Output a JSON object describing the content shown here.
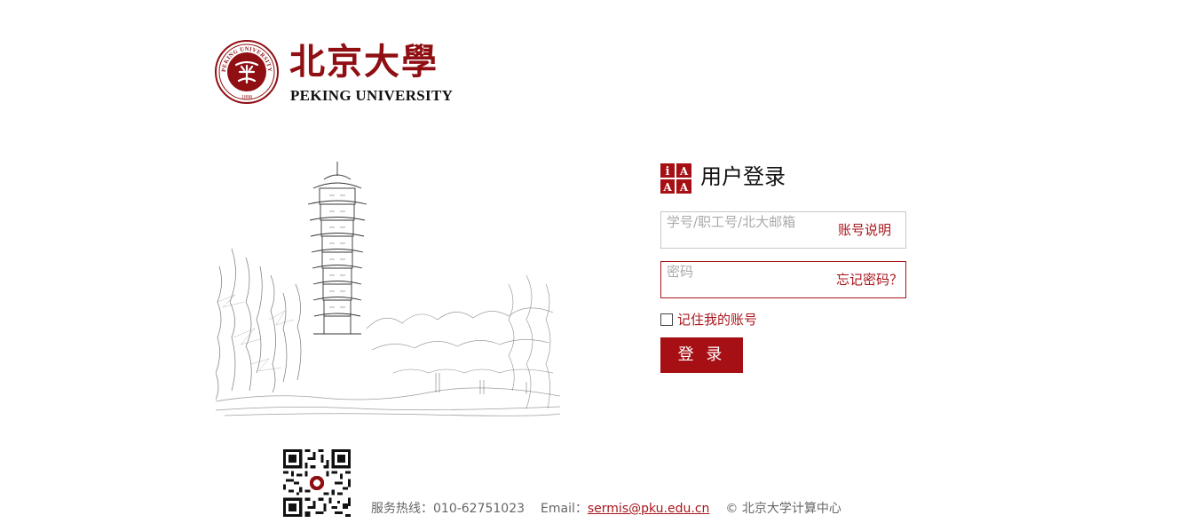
{
  "brand": {
    "name_cn": "北京大學",
    "name_en": "PEKING UNIVERSITY",
    "emblem_ring_text": "PEKING UNIVERSITY",
    "emblem_year": "1898",
    "color": "#8f0f13"
  },
  "login": {
    "title": "用户登录",
    "icon": "iaaa-icon",
    "username": {
      "value": "",
      "placeholder": "学号/职工号/北大邮箱",
      "help_link": "账号说明"
    },
    "password": {
      "value": "",
      "placeholder": "密码",
      "help_link": "忘记密码？"
    },
    "remember": {
      "label": "记住我的账号",
      "checked": false
    },
    "submit_label": "登 录",
    "accent_color": "#a60f14"
  },
  "footer": {
    "hotline_label": "服务热线：",
    "hotline": "010-62751023",
    "email_label": "Email：",
    "email": "sermis@pku.edu.cn",
    "copyright": "© 北京大学计算中心",
    "qr_icon": "qr-code-icon"
  }
}
